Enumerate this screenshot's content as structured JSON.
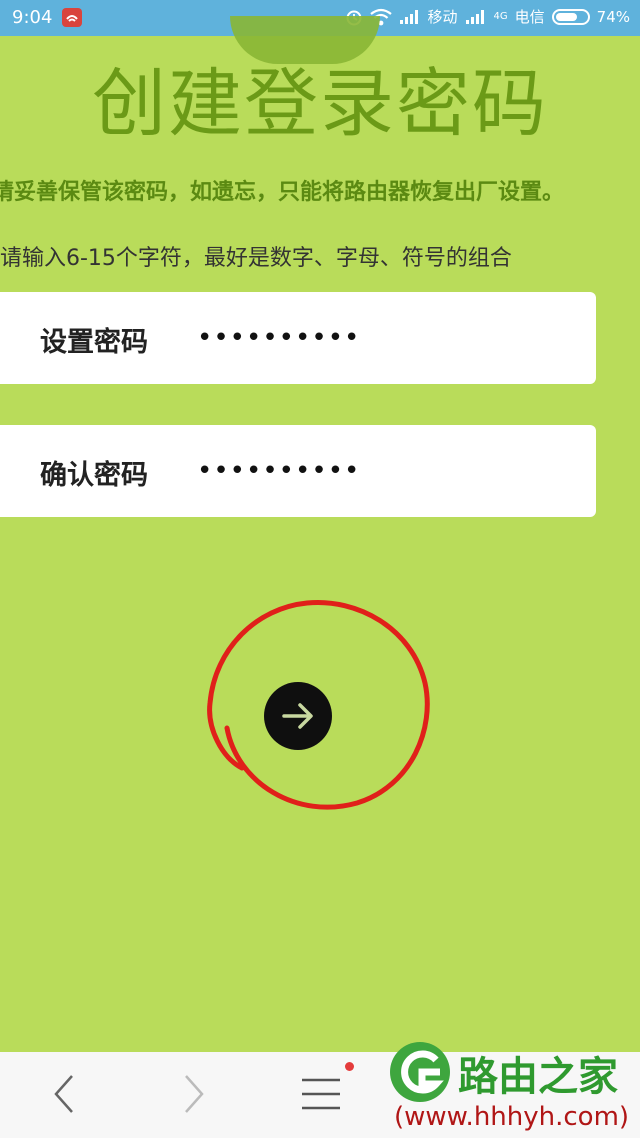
{
  "status_bar": {
    "time": "9:04",
    "carrier1": "移动",
    "network_badge": "4G",
    "carrier2": "电信",
    "battery": "74%",
    "battery_level": 0.74
  },
  "page": {
    "title": "创建登录密码",
    "warning": "请妥善保管该密码，如遗忘，只能将路由器恢复出厂设置。",
    "hint": "请输入6-15个字符，最好是数字、字母、符号的组合"
  },
  "form": {
    "set_password_label": "设置密码",
    "set_password_value": "••••••••••",
    "confirm_password_label": "确认密码",
    "confirm_password_value": "••••••••••"
  },
  "next_button": {
    "icon": "arrow-right-icon",
    "highlight_color": "#e0201a"
  },
  "browser_nav": {
    "back_icon": "chevron-left-icon",
    "forward_icon": "chevron-right-icon",
    "menu_icon": "menu-icon"
  },
  "watermark": {
    "name": "路由之家",
    "url": "(www.hhhyh.com)"
  },
  "colors": {
    "background": "#b9dc5a",
    "title": "#6b9a17",
    "status_bar": "#5fb2dc"
  }
}
